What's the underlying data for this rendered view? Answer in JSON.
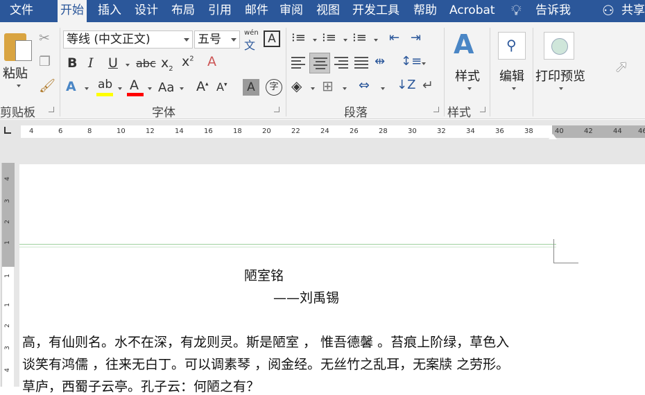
{
  "menu": {
    "tabs": [
      "文件",
      "开始",
      "插入",
      "设计",
      "布局",
      "引用",
      "邮件",
      "审阅",
      "视图",
      "开发工具",
      "帮助",
      "Acrobat"
    ],
    "active_tab": "开始",
    "tell_me": "告诉我",
    "share": "共享"
  },
  "ribbon": {
    "clipboard": {
      "paste_label": "粘贴",
      "group_label": "剪贴板"
    },
    "font": {
      "font_name": "等线 (中文正文)",
      "font_size": "五号",
      "phonetic_top": "wén",
      "phonetic_bottom": "文",
      "border_char": "A",
      "enclose_char": "字",
      "shade_char": "A",
      "case_label": "Aa",
      "group_label": "字体"
    },
    "paragraph": {
      "group_label": "段落"
    },
    "styles": {
      "label": "样式",
      "group_label": "样式"
    },
    "editing": {
      "label": "编辑"
    },
    "print_preview": {
      "label": "打印预览"
    }
  },
  "ruler": {
    "numbers": [
      "4",
      "6",
      "8",
      "10",
      "12",
      "14",
      "16",
      "18",
      "20",
      "22",
      "24",
      "26",
      "28",
      "30",
      "32",
      "34",
      "36",
      "38",
      "40",
      "42",
      "44",
      "46"
    ]
  },
  "vertical_ruler": {
    "numbers": [
      "4",
      "3",
      "2",
      "1",
      "1",
      "1",
      "2",
      "3",
      "4"
    ]
  },
  "document": {
    "title": "陋室铭",
    "author": "——刘禹锡",
    "lines": [
      "高，有仙则名。水不在深，有龙则灵。斯是陋室 ， 惟吾德馨 。苔痕上阶绿，草色入",
      "谈笑有鸿儒 ，往来无白丁。可以调素琴 ，阅金经。无丝竹之乱耳，无案牍 之劳形。",
      "草庐，西蜀子云亭。孔子云：何陋之有？"
    ]
  },
  "colors": {
    "accent": "#2b579a",
    "highlight": "#ffff00",
    "font_color": "#ff0000"
  }
}
